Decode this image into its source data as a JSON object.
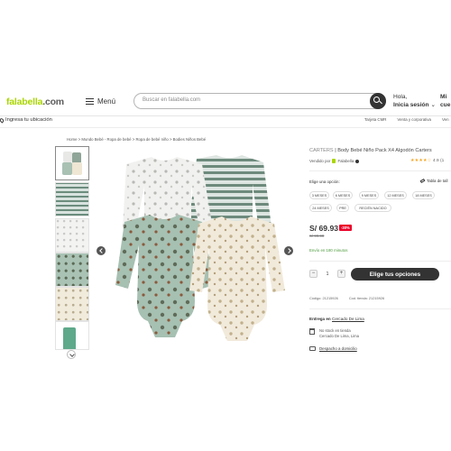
{
  "header": {
    "logo": "falabella",
    "logo_suffix": ".com",
    "menu_label": "Menú",
    "search_placeholder": "Buscar en falabella.com",
    "greeting_line1": "Hola,",
    "greeting_line2": "Inicia sesión",
    "truncated_label_line1": "Mi",
    "truncated_label_line2": "cue"
  },
  "subbar": {
    "location": "Ingresa tu ubicación",
    "links": [
      "Tarjeta CMR",
      "Venta y corporativa",
      "Ven"
    ]
  },
  "breadcrumb": "Home  >  Mundo Bebé - Ropa de bebé  >  Ropa de bebé niño  >  Bodies Niños Bebé",
  "product": {
    "brand": "CARTERS",
    "title": "Body Bebé Niño Pack X4 Algodón Carters",
    "sold_by_label": "Vendido por",
    "seller": "Falabella",
    "rating_stars": "★★★★☆",
    "rating_value": "4.9 (1",
    "size_label": "Elige una opción:",
    "size_chart": "Tabla de tall",
    "sizes": [
      "3 MESES",
      "6 MESES",
      "9 MESES",
      "12 MESES",
      "18 MESES",
      "24 MESES",
      "PRE",
      "RECIÉN NACIDO"
    ],
    "price": "S/ 69.93",
    "discount": "-30%",
    "old_price": "S/ 99.90",
    "delivery_note": "Envío en 180 minutos",
    "quantity": "1",
    "add_button": "Elige tus opciones",
    "code_label": "Código: 21215926",
    "seller_code": "Cod. tienda: 21215926",
    "entrega_label": "Entrega en",
    "entrega_location": "Cercado De Lima",
    "store_line1": "No stock en tienda",
    "store_line2": "Cercado De Lima, Lima",
    "shipping_link": "Despacho a domicilio"
  },
  "colors": {
    "brand_green": "#aad500",
    "button_dark": "#333333",
    "discount_red": "#eb0029",
    "delivery_green": "#4a9a3a"
  }
}
